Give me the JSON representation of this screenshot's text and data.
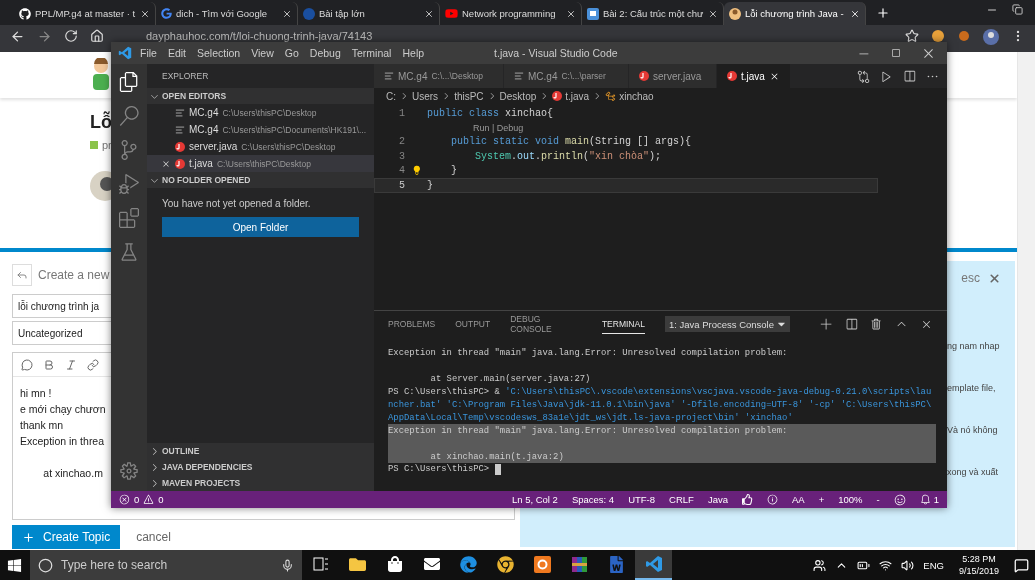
{
  "browser": {
    "tabs": [
      {
        "title": "PPL/MP.g4 at master · t",
        "kind": "github",
        "selected": false
      },
      {
        "title": "dich - Tìm với Google",
        "kind": "google",
        "selected": false
      },
      {
        "title": "Bài tập lớn",
        "kind": "circle",
        "selected": false
      },
      {
        "title": "Network programming",
        "kind": "youtube",
        "selected": false
      },
      {
        "title": "Bài 2: Cấu trúc một chư",
        "kind": "page",
        "selected": false
      },
      {
        "title": "Lỗi chương trình Java -",
        "kind": "avatar",
        "selected": true
      }
    ],
    "url": "dayphauhoc.com/t/loi-chuong-trinh-java/74143"
  },
  "page": {
    "title": "Lỗ",
    "category": "pr",
    "composer": {
      "reply_label": "Create a new",
      "title_value": "lỗi chương trình ja",
      "category_value": "Uncategorized",
      "body_lines": [
        {
          "kind": "text",
          "text": "hi mn !"
        },
        {
          "kind": "text",
          "text": "e mới chạy chươn"
        },
        {
          "kind": "text",
          "text": "thank mn"
        },
        {
          "kind": "text",
          "text": "Exception in threa"
        },
        {
          "kind": "blank"
        },
        {
          "kind": "text",
          "text": "\tat xinchao.m"
        }
      ],
      "submit": "Create Topic",
      "cancel": "cancel"
    },
    "help_panel": {
      "esc": "esc",
      "lines": [
        "ng nam nhap",
        "emplate file,",
        "Và nó không",
        "xong và xuất"
      ]
    }
  },
  "vscode": {
    "title": "t.java - Visual Studio Code",
    "menu": [
      "File",
      "Edit",
      "Selection",
      "View",
      "Go",
      "Debug",
      "Terminal",
      "Help"
    ],
    "activity": [
      {
        "kind": "files",
        "selected": true
      },
      {
        "kind": "search",
        "selected": false
      },
      {
        "kind": "scm",
        "selected": false
      },
      {
        "kind": "debug",
        "selected": false
      },
      {
        "kind": "extensions",
        "selected": false
      },
      {
        "kind": "test",
        "selected": false
      }
    ],
    "sidebar": {
      "title": "EXPLORER",
      "sections": [
        {
          "title": "OPEN EDITORS",
          "expanded": true,
          "items": [
            {
              "name": "MC.g4",
              "path": "C:\\Users\\thisPC\\Desktop",
              "kind": "text",
              "selected": false
            },
            {
              "name": "MC.g4",
              "path": "C:\\Users\\thisPC\\Documents\\HK191\\...",
              "kind": "text",
              "selected": false
            },
            {
              "name": "server.java",
              "path": "C:\\Users\\thisPC\\Desktop",
              "kind": "java",
              "selected": false
            },
            {
              "name": "t.java",
              "path": "C:\\Users\\thisPC\\Desktop",
              "kind": "java",
              "selected": true
            }
          ]
        },
        {
          "title": "NO FOLDER OPENED",
          "expanded": true,
          "message": "You have not yet opened a folder.",
          "button": "Open Folder"
        },
        {
          "title": "OUTLINE",
          "expanded": false
        },
        {
          "title": "JAVA DEPENDENCIES",
          "expanded": false
        },
        {
          "title": "MAVEN PROJECTS",
          "expanded": false
        }
      ]
    },
    "editor_tabs": [
      {
        "name": "MC.g4",
        "path": "C:\\...\\Desktop",
        "kind": "text",
        "selected": false
      },
      {
        "name": "MC.g4",
        "path": "C:\\...\\parser",
        "kind": "text",
        "selected": false
      },
      {
        "name": "server.java",
        "kind": "java",
        "selected": false
      },
      {
        "name": "t.java",
        "kind": "java",
        "selected": true
      }
    ],
    "breadcrumb": [
      {
        "text": "C:",
        "kind": "folder"
      },
      {
        "text": "Users",
        "kind": "folder"
      },
      {
        "text": "thisPC",
        "kind": "folder"
      },
      {
        "text": "Desktop",
        "kind": "folder"
      },
      {
        "text": "t.java",
        "kind": "java"
      },
      {
        "text": "xinchao",
        "kind": "class"
      }
    ],
    "code": [
      {
        "kind": "line",
        "number": "1",
        "current": false,
        "lightbulb": false,
        "tokens": [
          {
            "kind": "keyword",
            "text": "public class"
          },
          {
            "kind": "plain",
            "text": " xinchao{"
          }
        ]
      },
      {
        "kind": "codelens",
        "text": "Run | Debug"
      },
      {
        "kind": "line",
        "number": "2",
        "current": false,
        "lightbulb": false,
        "tokens": [
          {
            "kind": "keyword",
            "text": "    public static void"
          },
          {
            "kind": "function",
            "text": " main"
          },
          {
            "kind": "plain",
            "text": "(String [] args){"
          }
        ]
      },
      {
        "kind": "line",
        "number": "3",
        "current": false,
        "lightbulb": false,
        "tokens": [
          {
            "kind": "type",
            "text": "        System"
          },
          {
            "kind": "plain",
            "text": "."
          },
          {
            "kind": "variable",
            "text": "out"
          },
          {
            "kind": "plain",
            "text": "."
          },
          {
            "kind": "function",
            "text": "println"
          },
          {
            "kind": "plain",
            "text": "("
          },
          {
            "kind": "string",
            "text": "\"xin chòa\""
          },
          {
            "kind": "plain",
            "text": ");"
          }
        ]
      },
      {
        "kind": "line",
        "number": "4",
        "current": false,
        "lightbulb": true,
        "tokens": [
          {
            "kind": "plain",
            "text": "    }"
          }
        ]
      },
      {
        "kind": "line",
        "number": "5",
        "current": true,
        "lightbulb": false,
        "tokens": [
          {
            "kind": "plain",
            "text": "}"
          }
        ]
      }
    ],
    "panel": {
      "tabs": [
        {
          "label": "PROBLEMS",
          "selected": false
        },
        {
          "label": "OUTPUT",
          "selected": false
        },
        {
          "label": "DEBUG CONSOLE",
          "selected": false
        },
        {
          "label": "TERMINAL",
          "selected": true
        }
      ],
      "terminal_select": "1: Java Process Console",
      "lines": [
        {
          "kind": "text",
          "selected": false,
          "cursor": false,
          "segments": [
            {
              "kind": "plain",
              "text": "Exception in thread \"main\" java.lang.Error: Unresolved compilation problem:"
            }
          ]
        },
        {
          "kind": "blank",
          "selected": false,
          "cursor": false
        },
        {
          "kind": "text",
          "selected": false,
          "cursor": false,
          "segments": [
            {
              "kind": "plain",
              "text": "        at Server.main(server.java:27)"
            }
          ]
        },
        {
          "kind": "text",
          "selected": false,
          "cursor": false,
          "segments": [
            {
              "kind": "plain",
              "text": "PS C:\\Users\\thisPC> & "
            },
            {
              "kind": "string",
              "text": "'C:\\Users\\thisPC\\.vscode\\extensions\\vscjava.vscode-java-debug-0.21.0\\scripts\\lau"
            }
          ]
        },
        {
          "kind": "text",
          "selected": false,
          "cursor": false,
          "segments": [
            {
              "kind": "string",
              "text": "ncher.bat' 'C:\\Program Files\\Java\\jdk-11.0.1\\bin\\java' '-Dfile.encoding=UTF-8' '-cp' 'C:\\Users\\thisPC\\"
            }
          ]
        },
        {
          "kind": "text",
          "selected": false,
          "cursor": false,
          "segments": [
            {
              "kind": "string",
              "text": "AppData\\Local\\Temp\\vscodesws_83a1e\\jdt_ws\\jdt.ls-java-project\\bin' 'xinchao'"
            }
          ]
        },
        {
          "kind": "text",
          "selected": true,
          "cursor": false,
          "segments": [
            {
              "kind": "plain",
              "text": "Exception in thread \"main\" java.lang.Error: Unresolved compilation problem:"
            }
          ]
        },
        {
          "kind": "blank",
          "selected": true,
          "cursor": false
        },
        {
          "kind": "text",
          "selected": true,
          "cursor": false,
          "segments": [
            {
              "kind": "plain",
              "text": "        at xinchao.main(t.java:2)"
            }
          ]
        },
        {
          "kind": "text",
          "selected": false,
          "cursor": true,
          "segments": [
            {
              "kind": "plain",
              "text": "PS C:\\Users\\thisPC> "
            }
          ]
        }
      ]
    },
    "status": {
      "errors": "0",
      "warnings": "0",
      "items": [
        {
          "kind": "text",
          "text": "Ln 5, Col 2"
        },
        {
          "kind": "text",
          "text": "Spaces: 4"
        },
        {
          "kind": "text",
          "text": "UTF-8"
        },
        {
          "kind": "text",
          "text": "CRLF"
        },
        {
          "kind": "text",
          "text": "Java"
        },
        {
          "kind": "thumbs"
        },
        {
          "kind": "info"
        },
        {
          "kind": "text",
          "text": "AA"
        },
        {
          "kind": "text",
          "text": "+"
        },
        {
          "kind": "text",
          "text": "100%"
        },
        {
          "kind": "text",
          "text": "-"
        },
        {
          "kind": "smiley"
        },
        {
          "kind": "bell",
          "text": "1"
        }
      ]
    }
  },
  "taskbar": {
    "search_placeholder": "Type here to search",
    "apps": [
      {
        "kind": "taskview",
        "selected": false
      },
      {
        "kind": "folder",
        "selected": false
      },
      {
        "kind": "store",
        "selected": false
      },
      {
        "kind": "mail",
        "selected": false
      },
      {
        "kind": "edge",
        "selected": false
      },
      {
        "kind": "chrome",
        "selected": false
      },
      {
        "kind": "reader",
        "selected": false
      },
      {
        "kind": "archive",
        "selected": false
      },
      {
        "kind": "word",
        "selected": false
      },
      {
        "kind": "vscode",
        "selected": true
      }
    ],
    "language": "ENG",
    "time": "5:28 PM",
    "date": "9/15/2019"
  }
}
